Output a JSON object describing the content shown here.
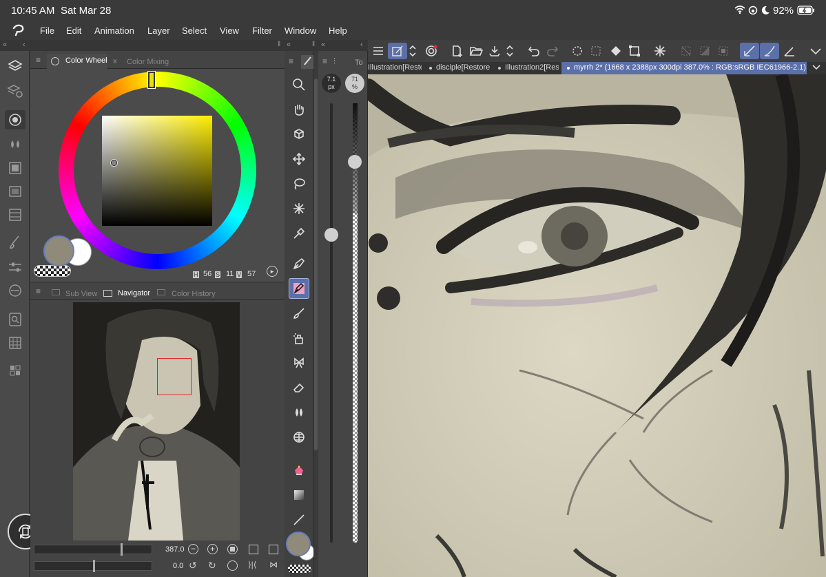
{
  "status": {
    "time": "10:45 AM",
    "date": "Sat Mar 28",
    "battery": "92%"
  },
  "menu": [
    "File",
    "Edit",
    "Animation",
    "Layer",
    "Select",
    "View",
    "Filter",
    "Window",
    "Help"
  ],
  "color_panel": {
    "tabs": [
      "Color Wheel",
      "Color Mixing"
    ],
    "hsv": {
      "h_label": "H",
      "h": "56",
      "s_label": "S",
      "s": "11",
      "v_label": "V",
      "v": "57"
    },
    "main_color": "#8f8a7a",
    "sub_color": "#ffffff"
  },
  "navigator_panel": {
    "tabs": [
      "Sub View",
      "Navigator",
      "Color History"
    ],
    "zoom": "387.0",
    "rotation": "0.0"
  },
  "tool_panel_tab": "To",
  "brush": {
    "size": "7.1",
    "size_unit": "px",
    "opacity": "71",
    "opacity_unit": "%",
    "size_level": 0.07,
    "opacity_level": 0.71
  },
  "documents": [
    {
      "label": "Illustration[Resto"
    },
    {
      "label": "disciple[Restore"
    },
    {
      "label": "Illustration2[Res"
    },
    {
      "label": "myrrh 2* (1668 x 2388px 300dpi 387.0% : RGB:sRGB IEC61966-2.1)",
      "active": true
    }
  ],
  "colors": {
    "accent": "#6a7db5",
    "active_tool": "#5b6fa8"
  }
}
